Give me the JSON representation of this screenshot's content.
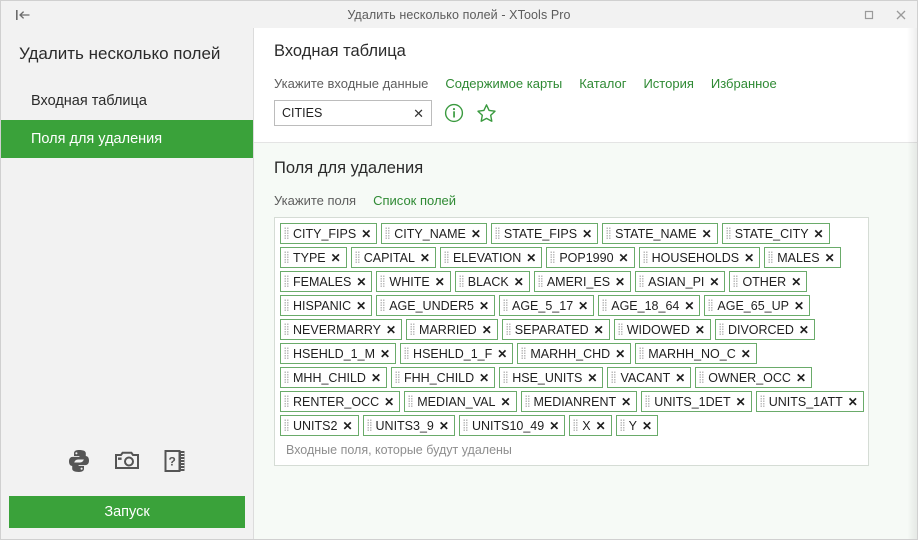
{
  "window": {
    "title": "Удалить несколько полей - XTools Pro",
    "collapse_icon": "collapse-left-icon",
    "maximize_icon": "maximize-icon",
    "close_icon": "close-icon"
  },
  "sidebar": {
    "title": "Удалить несколько полей",
    "items": [
      {
        "label": "Входная таблица",
        "active": false
      },
      {
        "label": "Поля для удаления",
        "active": true
      }
    ],
    "tool_icons": [
      {
        "name": "python-icon"
      },
      {
        "name": "camera-icon"
      },
      {
        "name": "help-book-icon"
      }
    ],
    "run_label": "Запуск"
  },
  "input_section": {
    "title": "Входная таблица",
    "label": "Укажите входные данные",
    "links": [
      "Содержимое карты",
      "Каталог",
      "История",
      "Избранное"
    ],
    "combo_value": "CITIES",
    "clear_glyph": "✕",
    "info_icon": "info-icon",
    "favorite_icon": "star-icon"
  },
  "fields_section": {
    "title": "Поля для удаления",
    "label": "Укажите поля",
    "link": "Список полей",
    "placeholder": "Входные поля, которые будут удалены",
    "remove_glyph": "✕",
    "tags": [
      "CITY_FIPS",
      "CITY_NAME",
      "STATE_FIPS",
      "STATE_NAME",
      "STATE_CITY",
      "TYPE",
      "CAPITAL",
      "ELEVATION",
      "POP1990",
      "HOUSEHOLDS",
      "MALES",
      "FEMALES",
      "WHITE",
      "BLACK",
      "AMERI_ES",
      "ASIAN_PI",
      "OTHER",
      "HISPANIC",
      "AGE_UNDER5",
      "AGE_5_17",
      "AGE_18_64",
      "AGE_65_UP",
      "NEVERMARRY",
      "MARRIED",
      "SEPARATED",
      "WIDOWED",
      "DIVORCED",
      "HSEHLD_1_M",
      "HSEHLD_1_F",
      "MARHH_CHD",
      "MARHH_NO_C",
      "MHH_CHILD",
      "FHH_CHILD",
      "HSE_UNITS",
      "VACANT",
      "OWNER_OCC",
      "RENTER_OCC",
      "MEDIAN_VAL",
      "MEDIANRENT",
      "UNITS_1DET",
      "UNITS_1ATT",
      "UNITS2",
      "UNITS3_9",
      "UNITS10_49",
      "X",
      "Y"
    ]
  },
  "colors": {
    "accent_green": "#3aa23a",
    "link_green": "#2f8a34",
    "tag_border": "#6aab6a",
    "sidebar_bg": "#f2f2f2",
    "fields_bg": "#f6faf6"
  }
}
